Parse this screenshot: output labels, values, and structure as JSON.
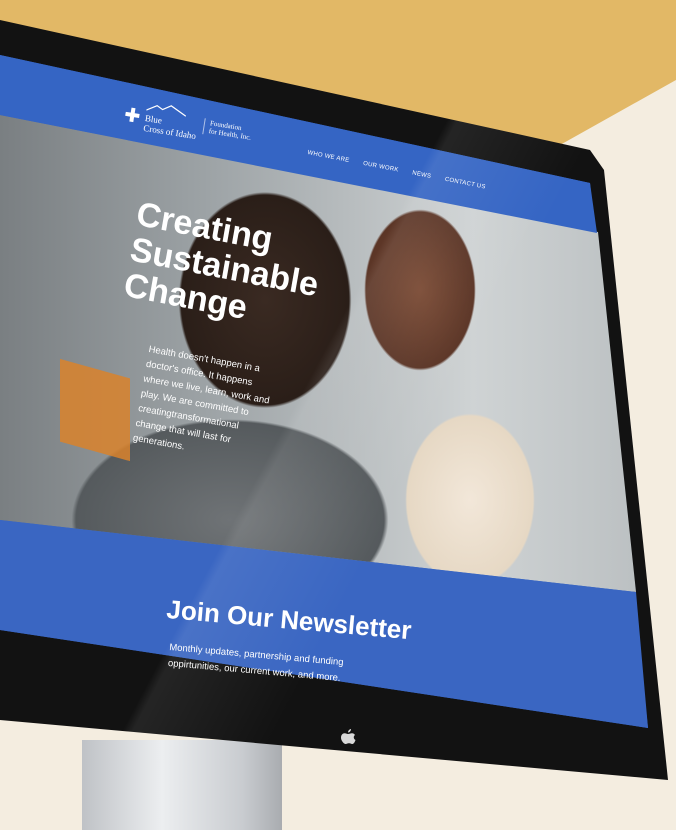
{
  "brand": {
    "name_line1": "Blue",
    "name_line2": "Cross of Idaho",
    "sub_line1": "Foundation",
    "sub_line2": "for Health, Inc."
  },
  "nav": {
    "items": [
      "WHO WE ARE",
      "OUR WORK",
      "NEWS",
      "CONTACT US"
    ]
  },
  "hero": {
    "title_lines": [
      "Creating",
      "Sustainable",
      "Change"
    ],
    "body": "Health doesn't happen in a doctor's office. It happens where we live, learn, work and play. We are committed to creatingtransformational change that will last for generations."
  },
  "newsletter": {
    "title": "Join Our Newsletter",
    "body": "Monthly updates, partnership and funding oppirtunities, our current work, and more."
  },
  "icons": {
    "brand_logo": "cross-icon",
    "monitor_logo": "apple-icon"
  },
  "colors": {
    "brand_blue": "#3565c4",
    "background_gold": "#e2b866",
    "background_cream": "#f4ede0"
  }
}
